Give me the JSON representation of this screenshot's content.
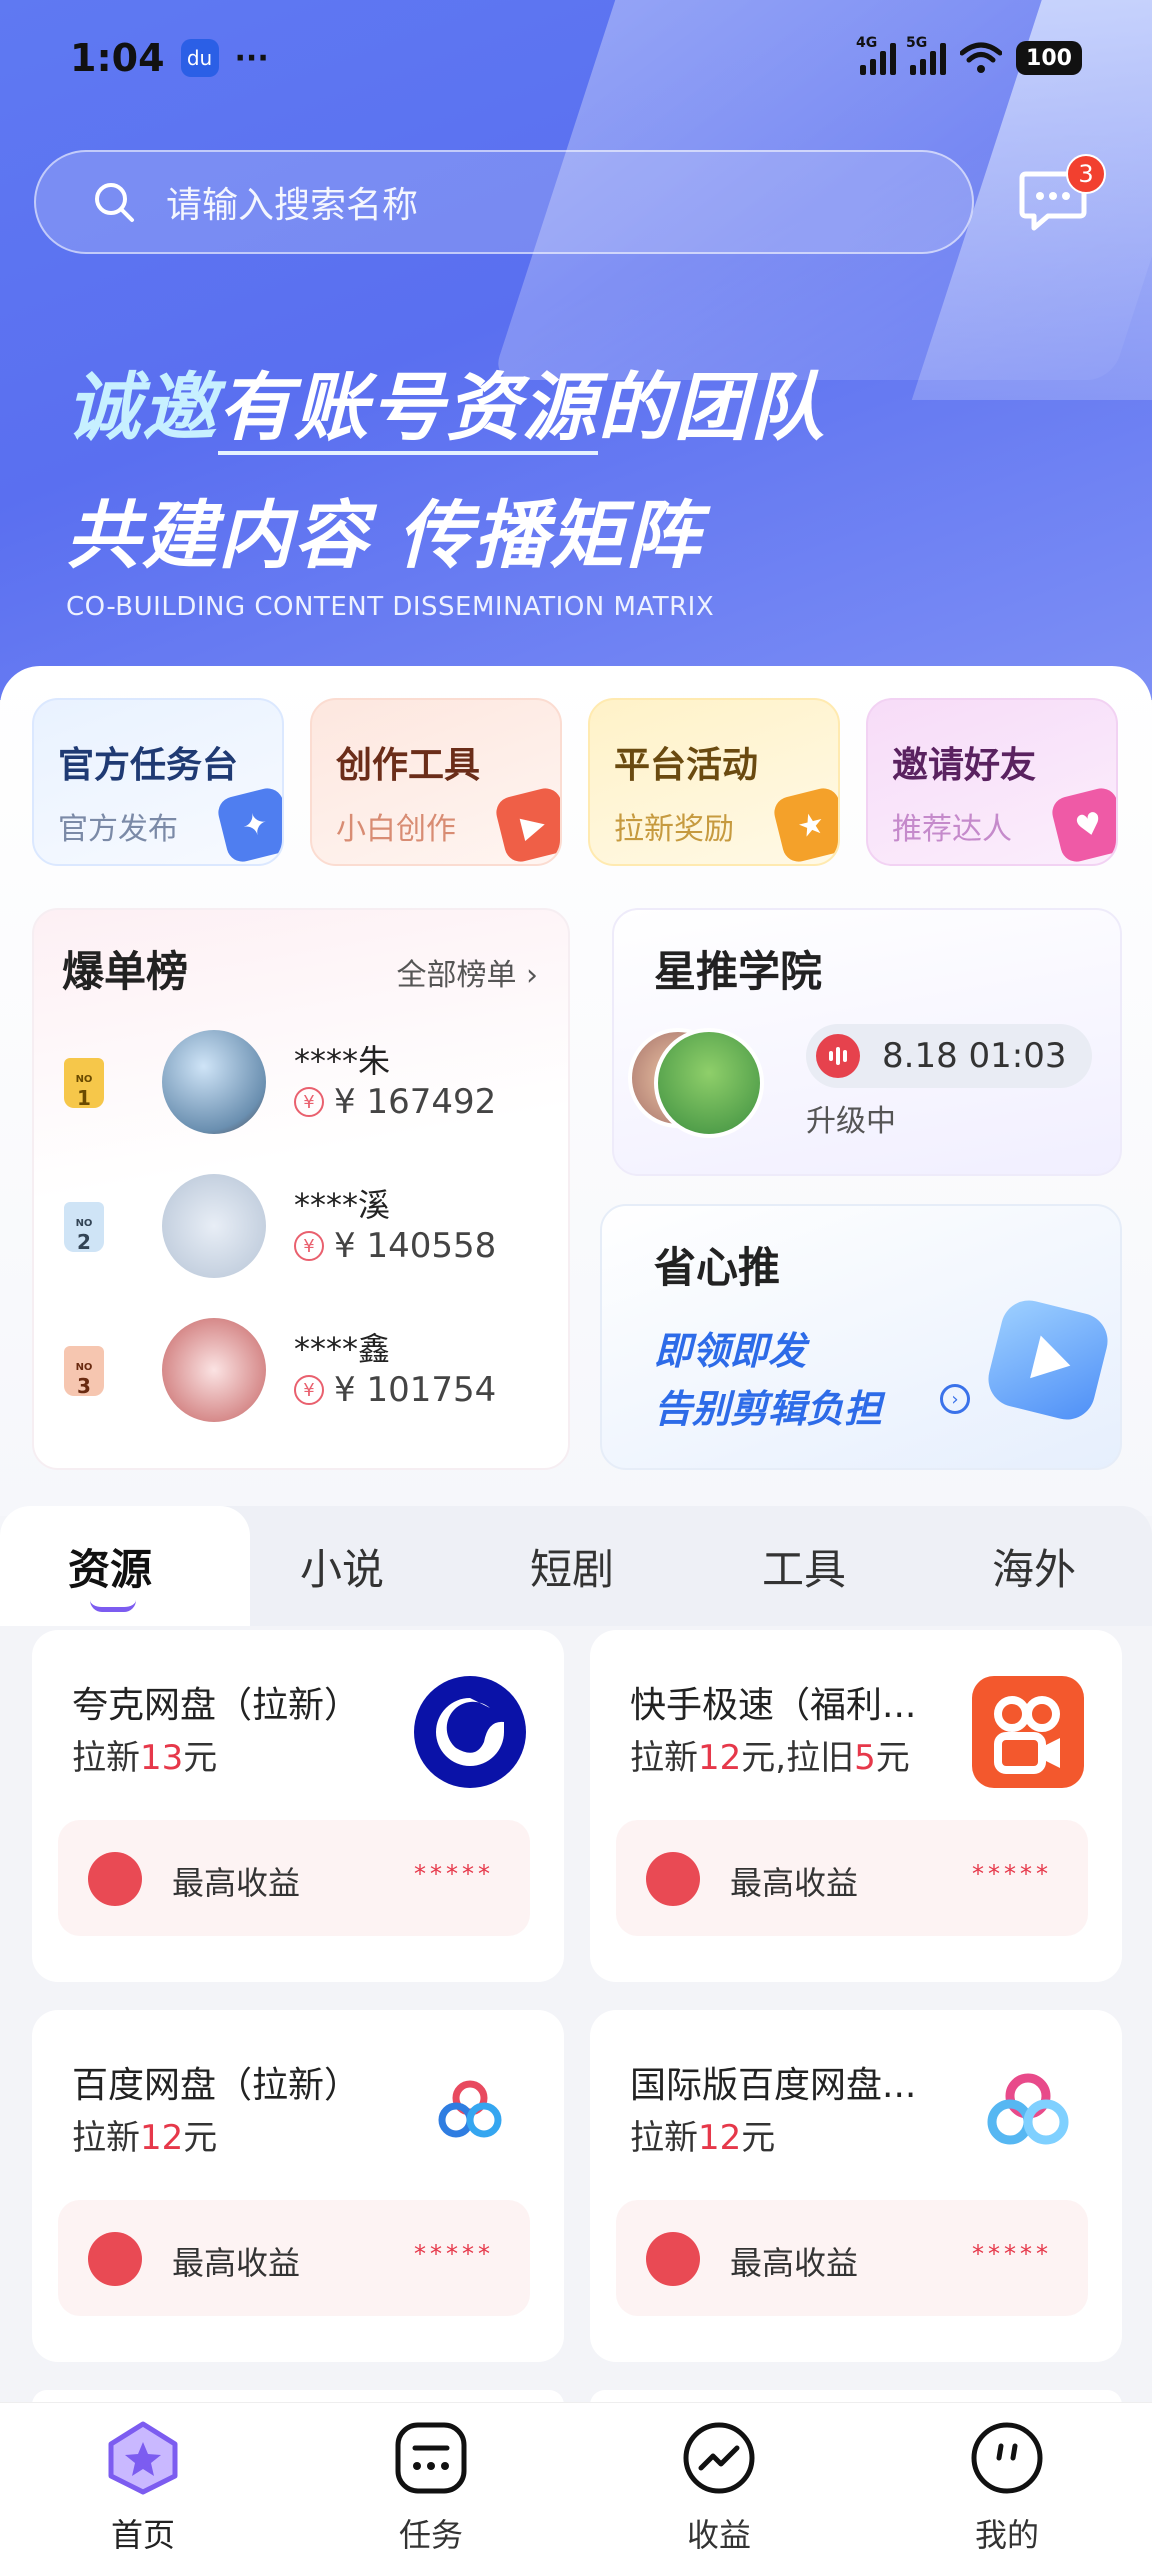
{
  "status_bar": {
    "time": "1:04",
    "net1": "4G",
    "net2": "5G",
    "battery": "100"
  },
  "header": {
    "search_placeholder": "请输入搜索名称",
    "message_badge": "3",
    "slogan_line1_a": "诚邀",
    "slogan_line1_b": "有账号资源",
    "slogan_line1_c": "的团队",
    "slogan_line2": "共建内容  传播矩阵",
    "slogan_en": "CO-BUILDING CONTENT DISSEMINATION MATRIX"
  },
  "quick_actions": [
    {
      "title": "官方任务台",
      "sub": "官方发布"
    },
    {
      "title": "创作工具",
      "sub": "小白创作"
    },
    {
      "title": "平台活动",
      "sub": "拉新奖励"
    },
    {
      "title": "邀请好友",
      "sub": "推荐达人"
    }
  ],
  "ranking": {
    "title": "爆单榜",
    "all_label": "全部榜单",
    "rows": [
      {
        "no": "1",
        "name": "****朱",
        "amount": "¥ 167492"
      },
      {
        "no": "2",
        "name": "****溪",
        "amount": "¥ 140558"
      },
      {
        "no": "3",
        "name": "****鑫",
        "amount": "¥ 101754"
      }
    ]
  },
  "academy": {
    "title": "星推学院",
    "live_time": "8.18 01:03",
    "status": "升级中"
  },
  "promo": {
    "title": "省心推",
    "line1": "即领即发",
    "line2": "告别剪辑负担"
  },
  "tabs": [
    "资源",
    "小说",
    "短剧",
    "工具",
    "海外"
  ],
  "cards": [
    {
      "name": "夸克网盘（拉新）",
      "desc_a": "拉新",
      "desc_b": "13",
      "desc_c": "元",
      "desc_d": "",
      "desc_e": "",
      "desc_f": "",
      "bar_label": "最高收益",
      "stars": "*****"
    },
    {
      "name": "快手极速（福利...",
      "desc_a": "拉新",
      "desc_b": "12",
      "desc_c": "元,拉旧",
      "desc_d": "5",
      "desc_e": "元",
      "desc_f": "",
      "bar_label": "最高收益",
      "stars": "*****"
    },
    {
      "name": "百度网盘（拉新）",
      "desc_a": "拉新",
      "desc_b": "12",
      "desc_c": "元",
      "desc_d": "",
      "desc_e": "",
      "desc_f": "",
      "bar_label": "最高收益",
      "stars": "*****"
    },
    {
      "name": "国际版百度网盘...",
      "desc_a": "拉新",
      "desc_b": "12",
      "desc_c": "元",
      "desc_d": "",
      "desc_e": "",
      "desc_f": "",
      "bar_label": "最高收益",
      "stars": "*****"
    }
  ],
  "bottom_nav": [
    {
      "label": "首页",
      "icon": "home-star-icon"
    },
    {
      "label": "任务",
      "icon": "task-chat-icon"
    },
    {
      "label": "收益",
      "icon": "earnings-trend-icon"
    },
    {
      "label": "我的",
      "icon": "profile-face-icon"
    }
  ],
  "colors": {
    "primary": "#5f79f2",
    "accent_red": "#e6384a",
    "active_purple": "#7c5cf0"
  }
}
